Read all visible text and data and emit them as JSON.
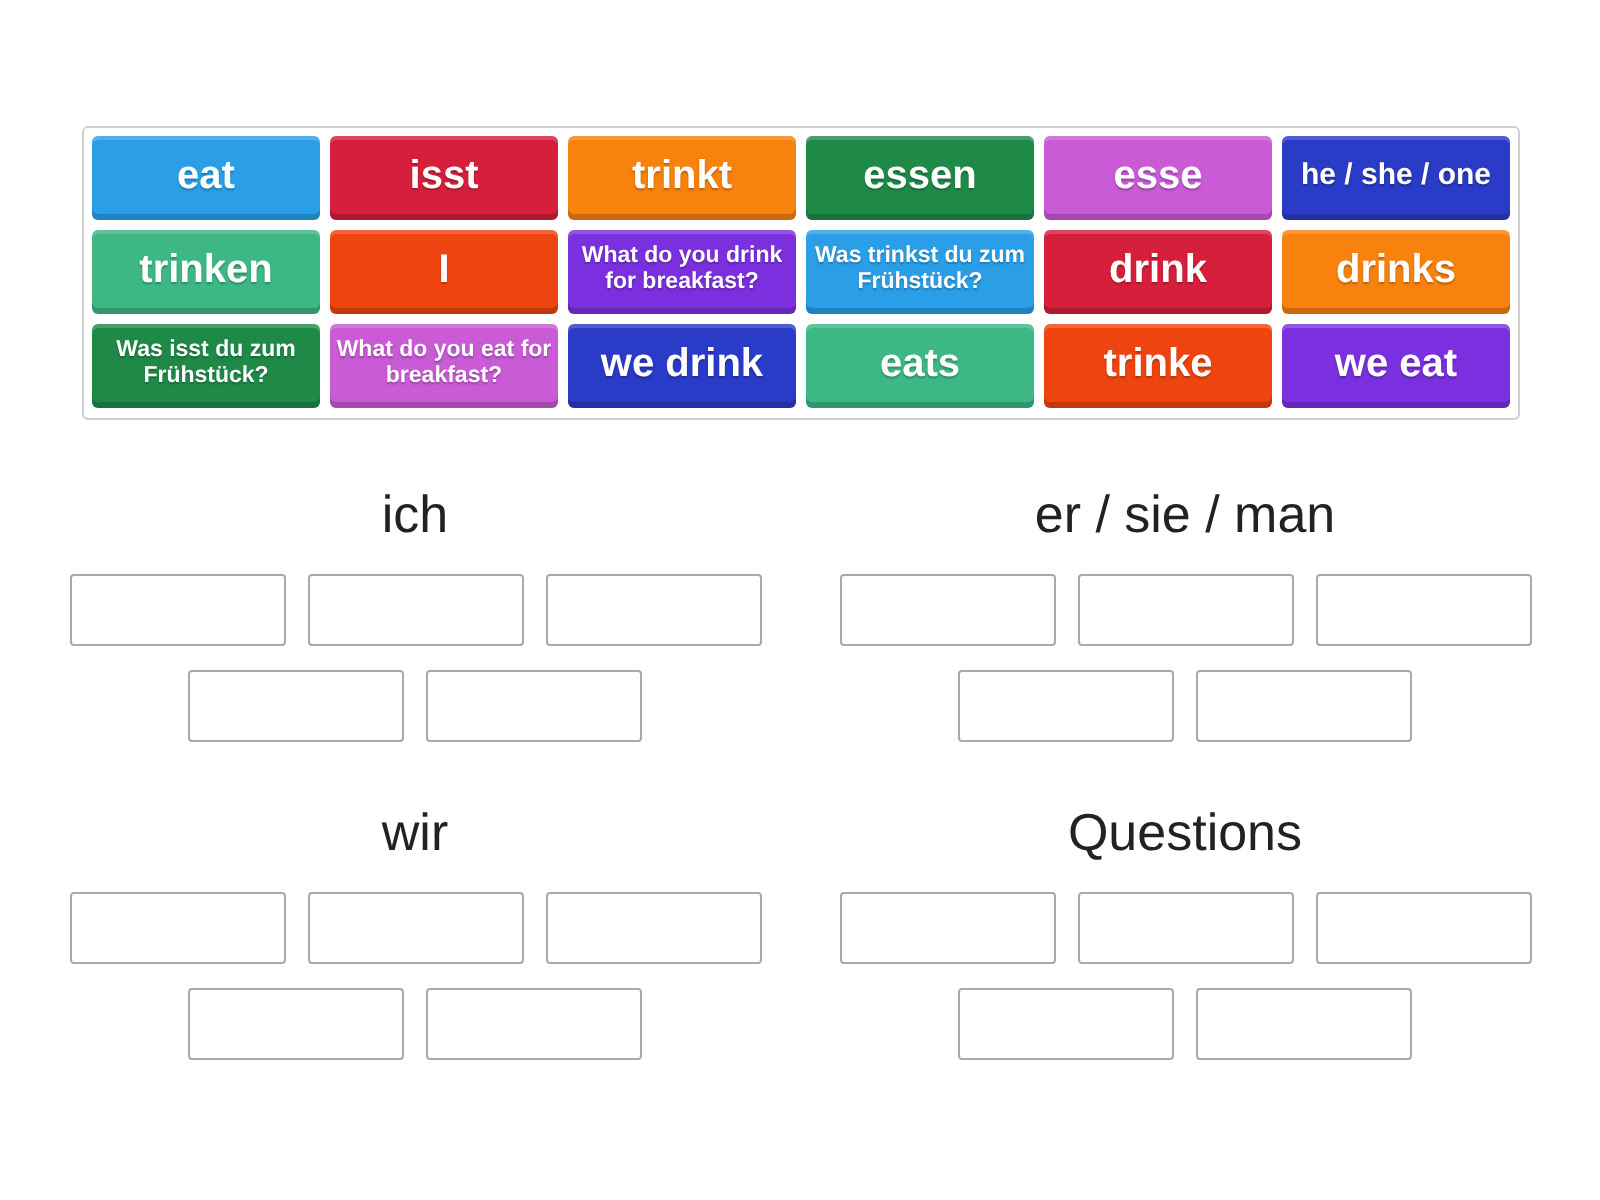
{
  "tiles": [
    {
      "text": "eat",
      "color": "#2a9fe8"
    },
    {
      "text": "isst",
      "color": "#d61f3a"
    },
    {
      "text": "trinkt",
      "color": "#f7820d"
    },
    {
      "text": "essen",
      "color": "#1f8a48"
    },
    {
      "text": "esse",
      "color": "#c95bd6"
    },
    {
      "text": "he / she / one",
      "color": "#2a3bc7"
    },
    {
      "text": "trinken",
      "color": "#3db884"
    },
    {
      "text": "I",
      "color": "#ee4510"
    },
    {
      "text": "What do you drink for breakfast?",
      "color": "#7a30de"
    },
    {
      "text": "Was trinkst du zum Frühstück?",
      "color": "#2a9fe8"
    },
    {
      "text": "drink",
      "color": "#d61f3a"
    },
    {
      "text": "drinks",
      "color": "#f7820d"
    },
    {
      "text": "Was isst du zum Frühstück?",
      "color": "#1f8a48"
    },
    {
      "text": "What do you eat for breakfast?",
      "color": "#c95bd6"
    },
    {
      "text": "we drink",
      "color": "#2a3bc7"
    },
    {
      "text": "eats",
      "color": "#3db884"
    },
    {
      "text": "trinke",
      "color": "#ee4510"
    },
    {
      "text": "we eat",
      "color": "#7a30de"
    }
  ],
  "groups": [
    {
      "heading": "ich",
      "answer_boxes": [
        {
          "filled": false
        },
        {
          "filled": false
        },
        {
          "filled": false
        },
        {
          "filled": false
        },
        {
          "filled": false
        }
      ]
    },
    {
      "heading": "er / sie / man",
      "answer_boxes": [
        {
          "filled": false
        },
        {
          "filled": false
        },
        {
          "filled": false
        },
        {
          "filled": false
        },
        {
          "filled": false
        }
      ]
    },
    {
      "heading": "wir",
      "answer_boxes": [
        {
          "filled": false
        },
        {
          "filled": false
        },
        {
          "filled": false
        },
        {
          "filled": false
        },
        {
          "filled": false
        }
      ]
    },
    {
      "heading": "Questions",
      "answer_boxes": [
        {
          "filled": false
        },
        {
          "filled": false
        },
        {
          "filled": false
        },
        {
          "filled": false
        },
        {
          "filled": false
        }
      ]
    }
  ]
}
